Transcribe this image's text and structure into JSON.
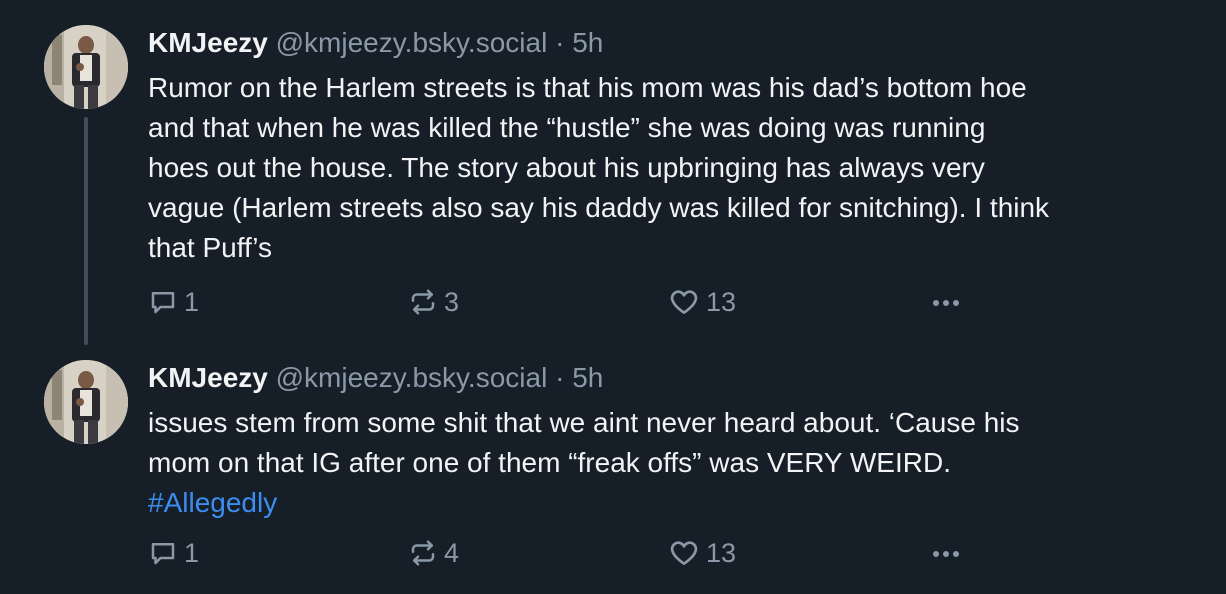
{
  "colors": {
    "background": "#161e27",
    "text": "#f1f3f5",
    "muted": "#8a98a8",
    "link": "#3b8ef0",
    "thread_line": "#3f4d5e"
  },
  "posts": [
    {
      "author": {
        "display_name": "KMJeezy",
        "handle": "@kmjeezy.bsky.social",
        "separator": "·",
        "time": "5h"
      },
      "lines": [
        "Rumor on the Harlem streets is that his mom was his dad’s bottom hoe",
        "and that when he was killed the “hustle” she was doing was running",
        "hoes out the house. The story about his upbringing has always very",
        "vague (Harlem streets also say his daddy was killed for snitching). I think",
        "that Puff’s"
      ],
      "hashtag": "",
      "actions": {
        "reply_count": "1",
        "repost_count": "3",
        "like_count": "13",
        "reply_icon": "speech-bubble-icon",
        "repost_icon": "repost-arrows-icon",
        "like_icon": "heart-icon",
        "more_icon": "ellipsis-icon"
      }
    },
    {
      "author": {
        "display_name": "KMJeezy",
        "handle": "@kmjeezy.bsky.social",
        "separator": "·",
        "time": "5h"
      },
      "lines": [
        "issues stem from some shit that we aint never heard about. ‘Cause his",
        "mom on that IG after one of them “freak offs” was VERY WEIRD."
      ],
      "hashtag": "#Allegedly",
      "actions": {
        "reply_count": "1",
        "repost_count": "4",
        "like_count": "13",
        "reply_icon": "speech-bubble-icon",
        "repost_icon": "repost-arrows-icon",
        "like_icon": "heart-icon",
        "more_icon": "ellipsis-icon"
      }
    }
  ]
}
